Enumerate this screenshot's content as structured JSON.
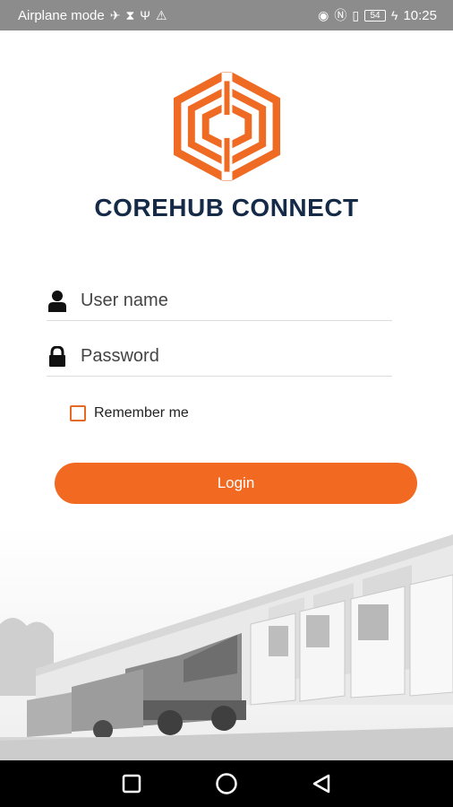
{
  "status_bar": {
    "mode_label": "Airplane mode",
    "battery_level": "54",
    "time": "10:25",
    "icons": [
      "airplane-icon",
      "hourglass-icon",
      "usb-icon",
      "warning-icon",
      "eye-icon",
      "nfc-icon",
      "vibrate-icon",
      "battery-icon",
      "charging-icon"
    ]
  },
  "brand": {
    "title": "COREHUB CONNECT",
    "accent_color": "#f26a22",
    "title_color": "#142a47"
  },
  "login_form": {
    "username_placeholder": "User name",
    "username_value": "",
    "password_placeholder": "Password",
    "password_value": "",
    "remember_label": "Remember me",
    "remember_checked": false,
    "login_label": "Login"
  },
  "background": {
    "image": "trucks-at-loading-docks"
  },
  "nav_bar": {
    "buttons": [
      "recents-button",
      "home-button",
      "back-button"
    ]
  }
}
